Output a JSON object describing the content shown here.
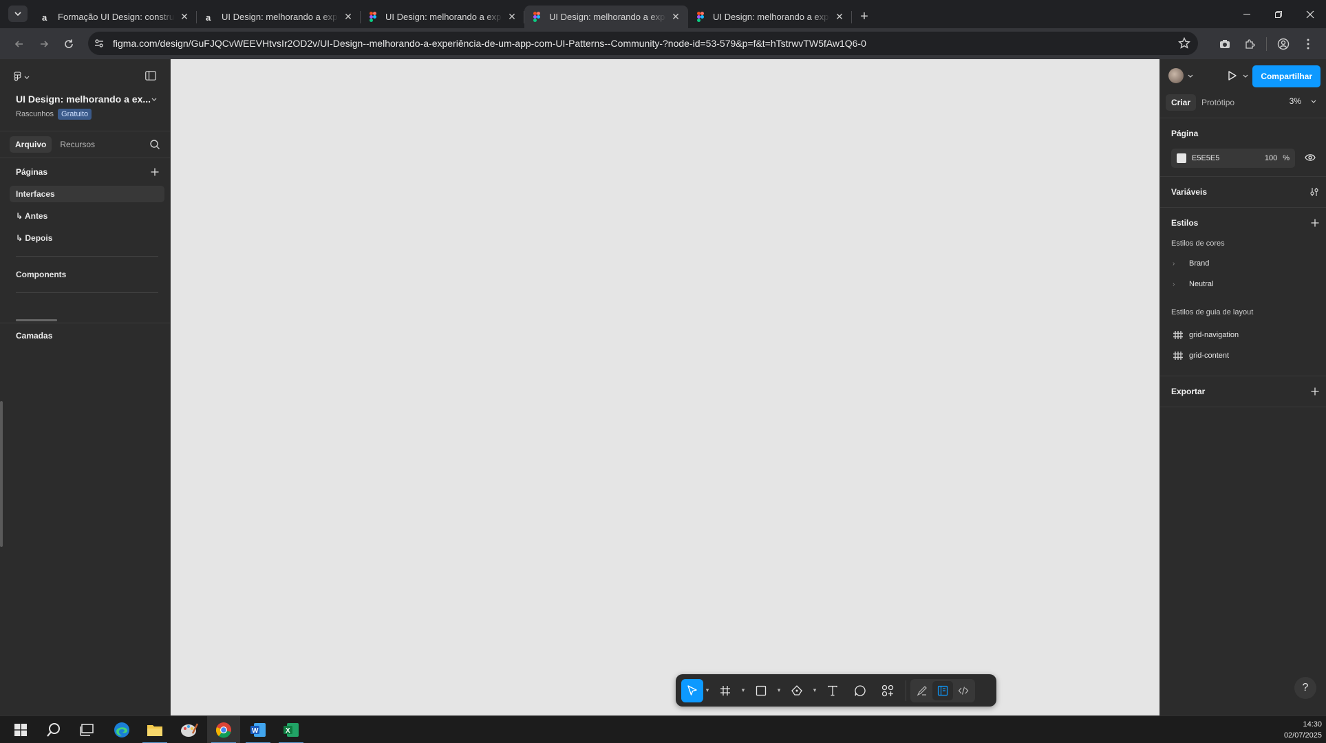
{
  "browser": {
    "tabs": [
      {
        "title": "Formação UI Design: construindo",
        "favicon": "alura-icon",
        "active": false
      },
      {
        "title": "UI Design: melhorando a experiência",
        "favicon": "alura-icon",
        "active": false
      },
      {
        "title": "UI Design: melhorando a experiência",
        "favicon": "figma-icon",
        "active": false
      },
      {
        "title": "UI Design: melhorando a experiência",
        "favicon": "figma-icon",
        "active": true
      },
      {
        "title": "UI Design: melhorando a experiência",
        "favicon": "figma-icon",
        "active": false
      }
    ],
    "url": "figma.com/design/GuFJQCvWEEVHtvsIr2OD2v/UI-Design--melhorando-a-experiência-de-um-app-com-UI-Patterns--Community-?node-id=53-579&p=f&t=hTstrwvTW5fAw1Q6-0"
  },
  "figma": {
    "file_title": "UI Design: melhorando a ex...",
    "location": "Rascunhos",
    "plan_badge": "Gratuito",
    "left_tabs": [
      "Arquivo",
      "Recursos"
    ],
    "pages_label": "Páginas",
    "pages": [
      "Interfaces",
      "↳ Antes",
      "↳ Depois"
    ],
    "components_label": "Components",
    "layers_label": "Camadas",
    "share_label": "Compartilhar",
    "right_tabs": [
      "Criar",
      "Protótipo"
    ],
    "zoom": "3%",
    "page_section": "Página",
    "page_fill_hex": "E5E5E5",
    "page_fill_opacity": "100",
    "percent_sign": "%",
    "variables_label": "Variáveis",
    "styles_label": "Estilos",
    "color_styles_label": "Estilos de cores",
    "color_styles": [
      "Brand",
      "Neutral"
    ],
    "layout_styles_label": "Estilos de guia de layout",
    "layout_styles": [
      "grid-navigation",
      "grid-content"
    ],
    "export_label": "Exportar",
    "help_label": "?",
    "canvas_color": "#e5e5e5",
    "accent_color": "#0d99ff"
  },
  "taskbar": {
    "time": "14:30",
    "date": "02/07/2025"
  }
}
